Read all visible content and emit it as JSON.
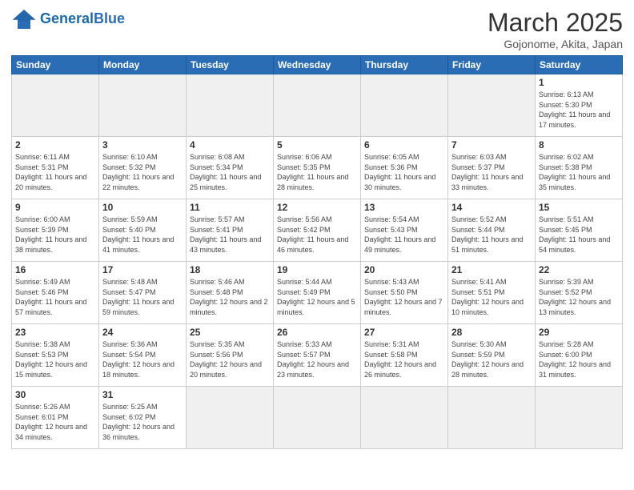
{
  "header": {
    "logo_general": "General",
    "logo_blue": "Blue",
    "month_title": "March 2025",
    "subtitle": "Gojonome, Akita, Japan"
  },
  "weekdays": [
    "Sunday",
    "Monday",
    "Tuesday",
    "Wednesday",
    "Thursday",
    "Friday",
    "Saturday"
  ],
  "weeks": [
    [
      {
        "day": "",
        "info": ""
      },
      {
        "day": "",
        "info": ""
      },
      {
        "day": "",
        "info": ""
      },
      {
        "day": "",
        "info": ""
      },
      {
        "day": "",
        "info": ""
      },
      {
        "day": "",
        "info": ""
      },
      {
        "day": "1",
        "info": "Sunrise: 6:13 AM\nSunset: 5:30 PM\nDaylight: 11 hours\nand 17 minutes."
      }
    ],
    [
      {
        "day": "2",
        "info": "Sunrise: 6:11 AM\nSunset: 5:31 PM\nDaylight: 11 hours\nand 20 minutes."
      },
      {
        "day": "3",
        "info": "Sunrise: 6:10 AM\nSunset: 5:32 PM\nDaylight: 11 hours\nand 22 minutes."
      },
      {
        "day": "4",
        "info": "Sunrise: 6:08 AM\nSunset: 5:34 PM\nDaylight: 11 hours\nand 25 minutes."
      },
      {
        "day": "5",
        "info": "Sunrise: 6:06 AM\nSunset: 5:35 PM\nDaylight: 11 hours\nand 28 minutes."
      },
      {
        "day": "6",
        "info": "Sunrise: 6:05 AM\nSunset: 5:36 PM\nDaylight: 11 hours\nand 30 minutes."
      },
      {
        "day": "7",
        "info": "Sunrise: 6:03 AM\nSunset: 5:37 PM\nDaylight: 11 hours\nand 33 minutes."
      },
      {
        "day": "8",
        "info": "Sunrise: 6:02 AM\nSunset: 5:38 PM\nDaylight: 11 hours\nand 35 minutes."
      }
    ],
    [
      {
        "day": "9",
        "info": "Sunrise: 6:00 AM\nSunset: 5:39 PM\nDaylight: 11 hours\nand 38 minutes."
      },
      {
        "day": "10",
        "info": "Sunrise: 5:59 AM\nSunset: 5:40 PM\nDaylight: 11 hours\nand 41 minutes."
      },
      {
        "day": "11",
        "info": "Sunrise: 5:57 AM\nSunset: 5:41 PM\nDaylight: 11 hours\nand 43 minutes."
      },
      {
        "day": "12",
        "info": "Sunrise: 5:56 AM\nSunset: 5:42 PM\nDaylight: 11 hours\nand 46 minutes."
      },
      {
        "day": "13",
        "info": "Sunrise: 5:54 AM\nSunset: 5:43 PM\nDaylight: 11 hours\nand 49 minutes."
      },
      {
        "day": "14",
        "info": "Sunrise: 5:52 AM\nSunset: 5:44 PM\nDaylight: 11 hours\nand 51 minutes."
      },
      {
        "day": "15",
        "info": "Sunrise: 5:51 AM\nSunset: 5:45 PM\nDaylight: 11 hours\nand 54 minutes."
      }
    ],
    [
      {
        "day": "16",
        "info": "Sunrise: 5:49 AM\nSunset: 5:46 PM\nDaylight: 11 hours\nand 57 minutes."
      },
      {
        "day": "17",
        "info": "Sunrise: 5:48 AM\nSunset: 5:47 PM\nDaylight: 11 hours\nand 59 minutes."
      },
      {
        "day": "18",
        "info": "Sunrise: 5:46 AM\nSunset: 5:48 PM\nDaylight: 12 hours\nand 2 minutes."
      },
      {
        "day": "19",
        "info": "Sunrise: 5:44 AM\nSunset: 5:49 PM\nDaylight: 12 hours\nand 5 minutes."
      },
      {
        "day": "20",
        "info": "Sunrise: 5:43 AM\nSunset: 5:50 PM\nDaylight: 12 hours\nand 7 minutes."
      },
      {
        "day": "21",
        "info": "Sunrise: 5:41 AM\nSunset: 5:51 PM\nDaylight: 12 hours\nand 10 minutes."
      },
      {
        "day": "22",
        "info": "Sunrise: 5:39 AM\nSunset: 5:52 PM\nDaylight: 12 hours\nand 13 minutes."
      }
    ],
    [
      {
        "day": "23",
        "info": "Sunrise: 5:38 AM\nSunset: 5:53 PM\nDaylight: 12 hours\nand 15 minutes."
      },
      {
        "day": "24",
        "info": "Sunrise: 5:36 AM\nSunset: 5:54 PM\nDaylight: 12 hours\nand 18 minutes."
      },
      {
        "day": "25",
        "info": "Sunrise: 5:35 AM\nSunset: 5:56 PM\nDaylight: 12 hours\nand 20 minutes."
      },
      {
        "day": "26",
        "info": "Sunrise: 5:33 AM\nSunset: 5:57 PM\nDaylight: 12 hours\nand 23 minutes."
      },
      {
        "day": "27",
        "info": "Sunrise: 5:31 AM\nSunset: 5:58 PM\nDaylight: 12 hours\nand 26 minutes."
      },
      {
        "day": "28",
        "info": "Sunrise: 5:30 AM\nSunset: 5:59 PM\nDaylight: 12 hours\nand 28 minutes."
      },
      {
        "day": "29",
        "info": "Sunrise: 5:28 AM\nSunset: 6:00 PM\nDaylight: 12 hours\nand 31 minutes."
      }
    ],
    [
      {
        "day": "30",
        "info": "Sunrise: 5:26 AM\nSunset: 6:01 PM\nDaylight: 12 hours\nand 34 minutes."
      },
      {
        "day": "31",
        "info": "Sunrise: 5:25 AM\nSunset: 6:02 PM\nDaylight: 12 hours\nand 36 minutes."
      },
      {
        "day": "",
        "info": ""
      },
      {
        "day": "",
        "info": ""
      },
      {
        "day": "",
        "info": ""
      },
      {
        "day": "",
        "info": ""
      },
      {
        "day": "",
        "info": ""
      }
    ]
  ]
}
